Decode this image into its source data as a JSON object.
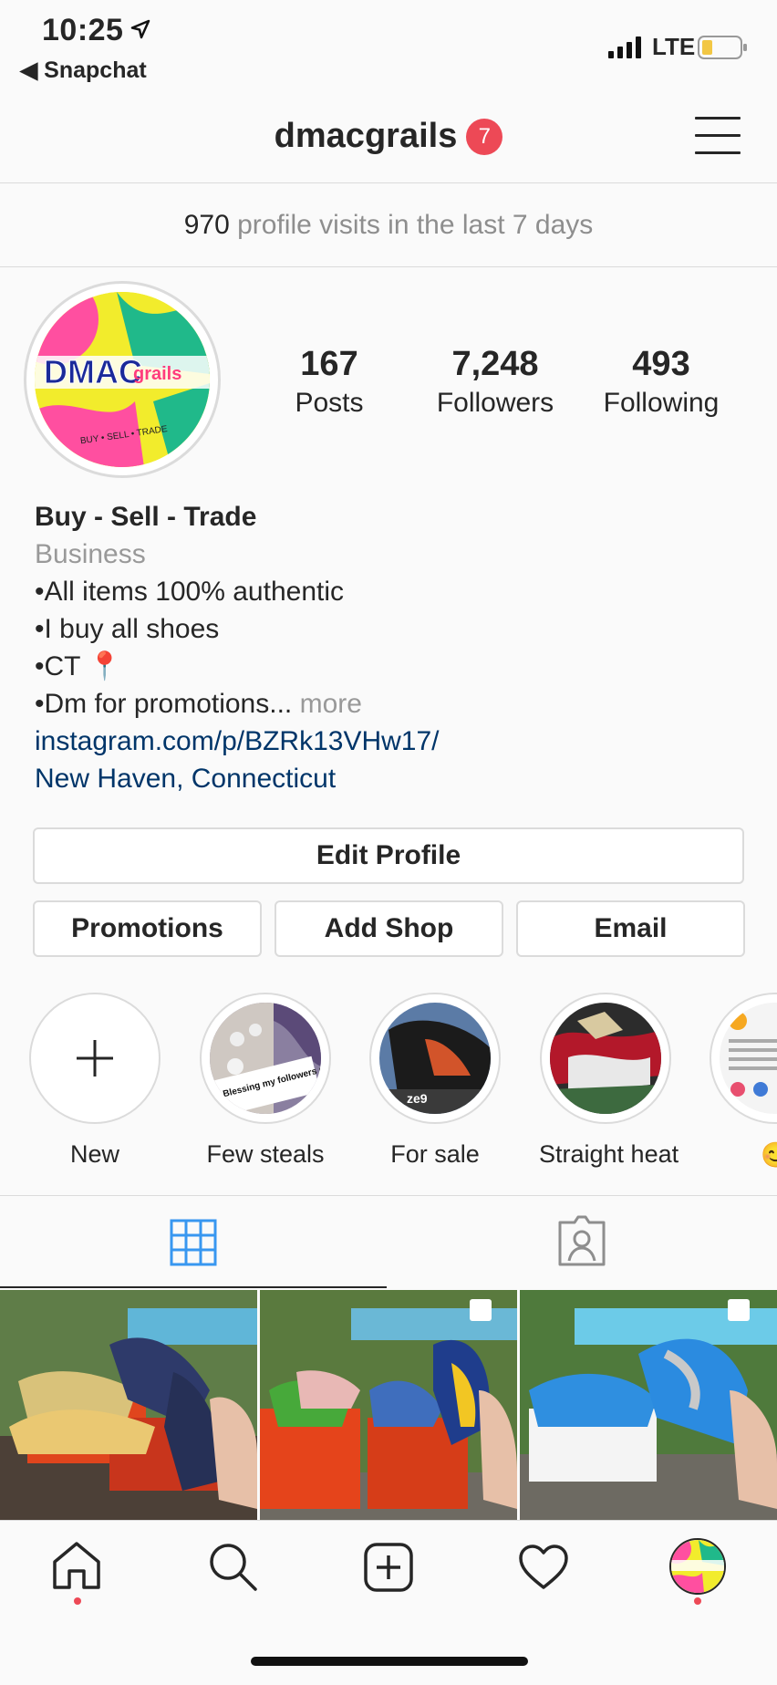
{
  "status_bar": {
    "time": "10:25",
    "back_app": "◀ Snapchat",
    "network": "LTE"
  },
  "header": {
    "username": "dmacgrails",
    "notification_count": "7"
  },
  "visits": {
    "count": "970",
    "text": "profile visits in the last 7 days"
  },
  "stats": [
    {
      "value": "167",
      "label": "Posts"
    },
    {
      "value": "7,248",
      "label": "Followers"
    },
    {
      "value": "493",
      "label": "Following"
    }
  ],
  "bio": {
    "name": "Buy - Sell - Trade",
    "category": "Business",
    "lines": [
      "•All items 100% authentic",
      "•I buy all shoes",
      "•CT 📍",
      "•Dm for promotions..."
    ],
    "more": "more",
    "link": "instagram.com/p/BZRk13VHw17/",
    "location": "New Haven, Connecticut"
  },
  "avatar": {
    "logo_text": "DMAC",
    "logo_sub": "grails",
    "tagline": "BUY • SELL • TRADE"
  },
  "buttons": {
    "edit_profile": "Edit Profile",
    "promotions": "Promotions",
    "add_shop": "Add Shop",
    "email": "Email"
  },
  "highlights": [
    {
      "label": "New"
    },
    {
      "label": "Few steals",
      "caption": "Blessing my followers got used to these deals"
    },
    {
      "label": "For sale",
      "caption": "ze9"
    },
    {
      "label": "Straight heat"
    },
    {
      "label": "😊"
    }
  ],
  "icons": {
    "grid": "grid-icon",
    "tagged": "tagged-icon",
    "home": "home-icon",
    "search": "search-icon",
    "add": "add-post-icon",
    "activity": "heart-icon",
    "profile": "profile-avatar-icon"
  },
  "colors": {
    "link": "#003569",
    "accent_blue": "#3897f0",
    "badge_red": "#ed4956",
    "border": "#dbdbdb"
  }
}
